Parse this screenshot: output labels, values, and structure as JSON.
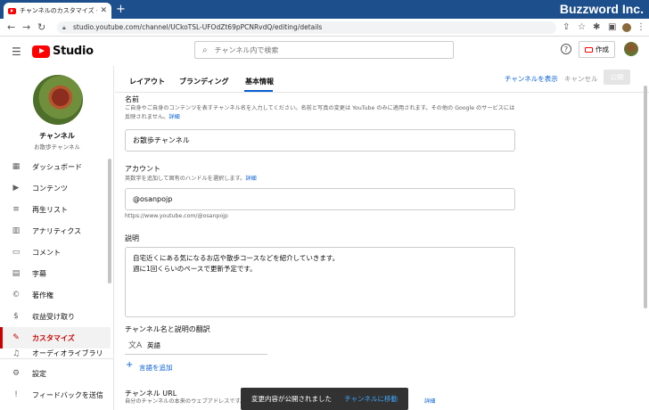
{
  "browser": {
    "tab_title": "チャンネルのカスタマイズ - YouTube Studio",
    "url": "studio.youtube.com/channel/UCkoTSL-UFOdZt69pPCNRvdQ/editing/details",
    "watermark": "Buzzword Inc."
  },
  "header": {
    "logo_text": "Studio",
    "search_placeholder": "チャンネル内で検索",
    "help_label": "?",
    "create_label": "作成"
  },
  "sidebar": {
    "channel_name": "チャンネル",
    "channel_sub": "お散歩チャンネル",
    "items": [
      {
        "label": "ダッシュボード",
        "icon": "dashboard-icon",
        "glyph": "▦"
      },
      {
        "label": "コンテンツ",
        "icon": "content-icon",
        "glyph": "▶"
      },
      {
        "label": "再生リスト",
        "icon": "playlist-icon",
        "glyph": "≡"
      },
      {
        "label": "アナリティクス",
        "icon": "analytics-icon",
        "glyph": "▥"
      },
      {
        "label": "コメント",
        "icon": "comment-icon",
        "glyph": "▭"
      },
      {
        "label": "字幕",
        "icon": "subtitles-icon",
        "glyph": "▤"
      },
      {
        "label": "著作権",
        "icon": "copyright-icon",
        "glyph": "©"
      },
      {
        "label": "収益受け取り",
        "icon": "monetization-icon",
        "glyph": "$"
      },
      {
        "label": "カスタマイズ",
        "icon": "customize-icon",
        "glyph": "✎"
      },
      {
        "label": "オーディオライブラリ",
        "icon": "audio-library-icon",
        "glyph": "♫"
      }
    ],
    "settings_label": "設定",
    "feedback_label": "フィードバックを送信"
  },
  "content_tabs": {
    "layout": "レイアウト",
    "branding": "ブランディング",
    "basic_info": "基本情報",
    "view_channel": "チャンネルを表示",
    "cancel": "キャンセル",
    "publish": "公開"
  },
  "name_section": {
    "title": "名前",
    "desc": "ご自身やご自身のコンテンツを表すチャンネル名を入力してください。名前と写真の変更は YouTube のみに適用されます。その他の Google のサービスには反映されません。",
    "link": "詳細",
    "value": "お散歩チャンネル"
  },
  "handle_section": {
    "title": "アカウント",
    "desc": "英数字を追加して固有のハンドルを選択します。",
    "link": "詳細",
    "value": "@osanpojp",
    "url": "https://www.youtube.com/@osanpojp"
  },
  "description_section": {
    "title": "説明",
    "line1": "自宅近くにある気になるお店や散歩コースなどを紹介していきます。",
    "line2": "週に1回くらいのペースで更新予定です。"
  },
  "translation_section": {
    "title": "チャンネル名と説明の翻訳",
    "language": "英語",
    "add_language": "言語を追加"
  },
  "url_section": {
    "title": "チャンネル URL",
    "desc": "自分のチャンネルの本来のウェブアドレスです。",
    "link": "詳細"
  },
  "toast": {
    "message": "変更内容が公開されました",
    "action": "チャンネルに移動"
  }
}
